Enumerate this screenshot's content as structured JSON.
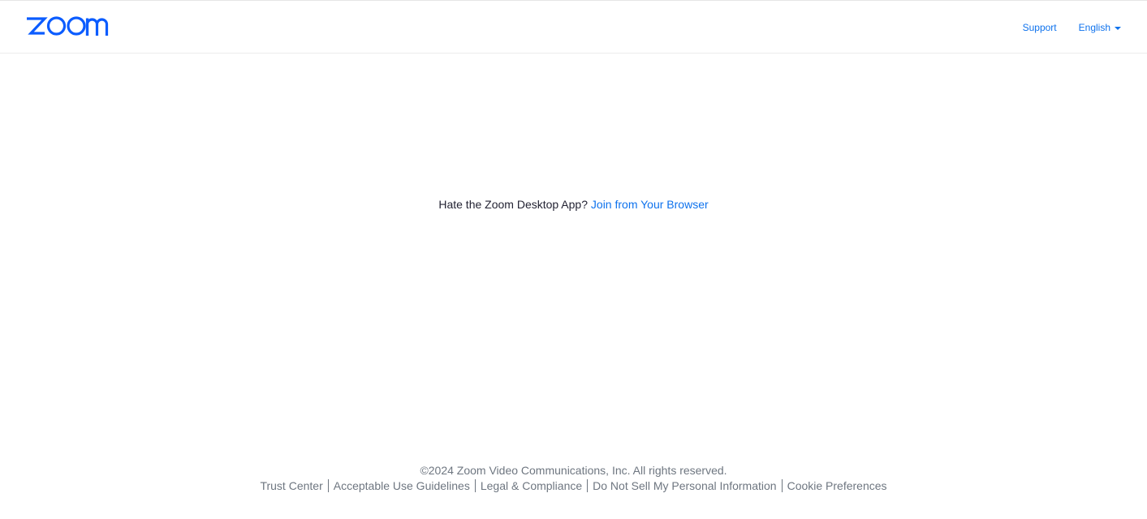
{
  "header": {
    "logo_text": "zoom",
    "support_label": "Support",
    "language_label": "English"
  },
  "main": {
    "prompt_text": "Hate the Zoom Desktop App?",
    "join_link_label": "Join from Your Browser"
  },
  "footer": {
    "copyright": "©2024 Zoom Video Communications, Inc. All rights reserved.",
    "links": [
      "Trust Center",
      "Acceptable Use Guidelines",
      "Legal & Compliance",
      "Do Not Sell My Personal Information",
      "Cookie Preferences"
    ]
  },
  "colors": {
    "brand_blue": "#0b5cff",
    "link_blue": "#0e72ed",
    "body_text": "#232333",
    "footer_text": "#6e7680"
  },
  "icons": {
    "logo": "zoom-logo-icon",
    "language_caret": "caret-down-icon"
  }
}
